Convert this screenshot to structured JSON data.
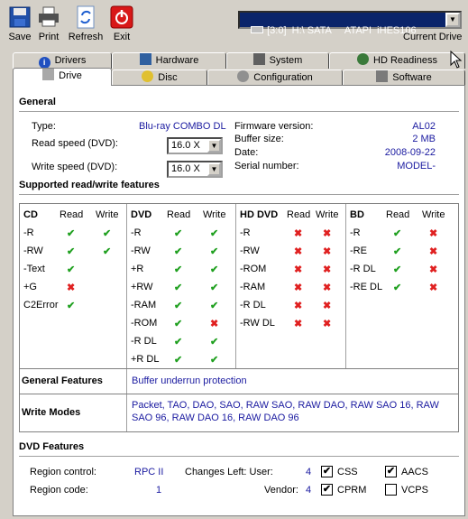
{
  "toolbar": {
    "save": "Save",
    "print": "Print",
    "refresh": "Refresh",
    "exit": "Exit"
  },
  "drive_selector": {
    "value": "[3:0]  H:\\ SATA     ATAPI  iHES106",
    "label": "Current Drive"
  },
  "tabs_row1": [
    "Drivers",
    "Hardware",
    "System",
    "HD Readiness"
  ],
  "tabs_row2": [
    "Drive",
    "Disc",
    "Configuration",
    "Software"
  ],
  "active_tab": "Drive",
  "general": {
    "title": "General",
    "type_label": "Type:",
    "type_value": "Blu-ray COMBO DL",
    "read_speed_label": "Read speed (DVD):",
    "read_speed_value": "16.0 X",
    "write_speed_label": "Write speed (DVD):",
    "write_speed_value": "16.0 X",
    "firmware_label": "Firmware version:",
    "firmware_value": "AL02",
    "buffer_label": "Buffer size:",
    "buffer_value": "2 MB",
    "date_label": "Date:",
    "date_value": "2008-09-22",
    "serial_label": "Serial number:",
    "serial_value": "MODEL-"
  },
  "features": {
    "title": "Supported read/write features",
    "read_label": "Read",
    "write_label": "Write",
    "cd": {
      "name": "CD",
      "rows": [
        {
          "label": "-R",
          "read": "yes",
          "write": "yes"
        },
        {
          "label": "-RW",
          "read": "yes",
          "write": "yes"
        },
        {
          "label": "-Text",
          "read": "yes",
          "write": ""
        },
        {
          "label": "+G",
          "read": "no",
          "write": ""
        },
        {
          "label": "C2Error",
          "read": "yes",
          "write": ""
        }
      ]
    },
    "dvd": {
      "name": "DVD",
      "rows": [
        {
          "label": "-R",
          "read": "yes",
          "write": "yes"
        },
        {
          "label": "-RW",
          "read": "yes",
          "write": "yes"
        },
        {
          "label": "+R",
          "read": "yes",
          "write": "yes"
        },
        {
          "label": "+RW",
          "read": "yes",
          "write": "yes"
        },
        {
          "label": "-RAM",
          "read": "yes",
          "write": "yes"
        },
        {
          "label": "-ROM",
          "read": "yes",
          "write": "no"
        },
        {
          "label": "-R DL",
          "read": "yes",
          "write": "yes"
        },
        {
          "label": "+R DL",
          "read": "yes",
          "write": "yes"
        }
      ]
    },
    "hddvd": {
      "name": "HD DVD",
      "rows": [
        {
          "label": "-R",
          "read": "no",
          "write": "no"
        },
        {
          "label": "-RW",
          "read": "no",
          "write": "no"
        },
        {
          "label": "-ROM",
          "read": "no",
          "write": "no"
        },
        {
          "label": "-RAM",
          "read": "no",
          "write": "no"
        },
        {
          "label": "-R DL",
          "read": "no",
          "write": "no"
        },
        {
          "label": "-RW DL",
          "read": "no",
          "write": "no"
        }
      ]
    },
    "bd": {
      "name": "BD",
      "rows": [
        {
          "label": "-R",
          "read": "yes",
          "write": "no"
        },
        {
          "label": "-RE",
          "read": "yes",
          "write": "no"
        },
        {
          "label": "-R DL",
          "read": "yes",
          "write": "no"
        },
        {
          "label": "-RE DL",
          "read": "yes",
          "write": "no"
        }
      ]
    }
  },
  "general_features": {
    "label": "General Features",
    "value": "Buffer underrun protection"
  },
  "write_modes": {
    "label": "Write Modes",
    "value": "Packet, TAO, DAO, SAO, RAW SAO, RAW DAO, RAW SAO 16, RAW SAO 96, RAW DAO 16, RAW DAO 96"
  },
  "dvd_features": {
    "title": "DVD Features",
    "region_control_label": "Region control:",
    "region_control_value": "RPC II",
    "region_code_label": "Region code:",
    "region_code_value": "1",
    "changes_user_label": "Changes Left: User:",
    "changes_user_value": "4",
    "vendor_label": "Vendor:",
    "vendor_value": "4",
    "css_label": "CSS",
    "css_checked": true,
    "aacs_label": "AACS",
    "aacs_checked": true,
    "cprm_label": "CPRM",
    "cprm_checked": true,
    "vcps_label": "VCPS",
    "vcps_checked": false
  },
  "colors": {
    "check": "#20a020",
    "cross": "#e02020",
    "value_blue": "#1a1aa0"
  }
}
